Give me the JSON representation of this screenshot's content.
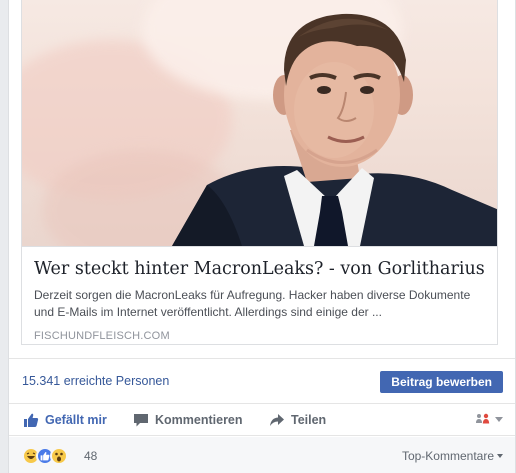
{
  "card": {
    "title": "Wer steckt hinter MacronLeaks? - von Gorlitharius",
    "description": "Derzeit sorgen die MacronLeaks für Aufregung. Hacker haben diverse Dokumente und E-Mails im Internet veröffentlicht. Allerdings sind einige der ...",
    "source": "FISCHUNDFLEISCH.COM"
  },
  "reach": {
    "text": "15.341 erreichte Personen",
    "boost_label": "Beitrag bewerben"
  },
  "actions": {
    "like_label": "Gefällt mir",
    "comment_label": "Kommentieren",
    "share_label": "Teilen"
  },
  "reactions": {
    "types": [
      "haha",
      "like",
      "wow"
    ],
    "count": "48",
    "sort_label": "Top-Kommentare"
  },
  "colors": {
    "link": "#365899",
    "button": "#4267b2",
    "action_text": "#606770"
  },
  "icons": [
    "thumbs-up-icon",
    "comment-icon",
    "share-arrow-icon",
    "audience-icon",
    "caret-down-icon"
  ]
}
